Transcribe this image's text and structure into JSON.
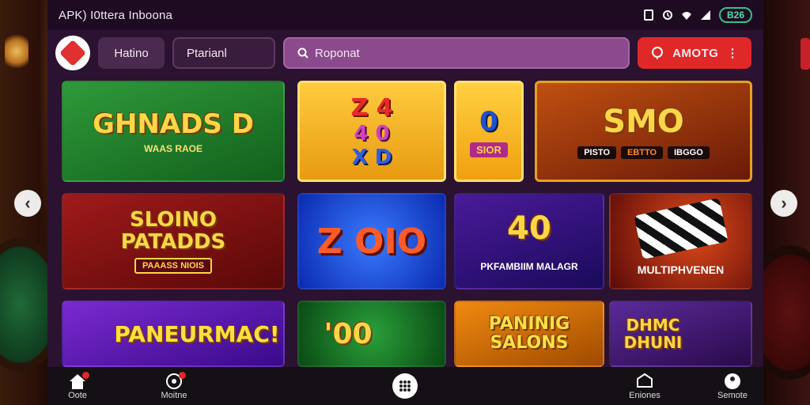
{
  "statusbar": {
    "title": "APK) I0ttera Inboona",
    "battery": "B26"
  },
  "topbar": {
    "pill_a": "Hatino",
    "pill_b": "Ptarianl",
    "search_placeholder": "Roponat",
    "promo_label": "AMOTG",
    "promo_menu": "⋮"
  },
  "tiles": {
    "t1": {
      "title": "GHNADS D",
      "subtitle": "WAAS RAOE"
    },
    "t2": {
      "line1": "Z 4",
      "line2": "4 0",
      "line3": "X D"
    },
    "t3": {
      "digit": "0",
      "label": "SIOR"
    },
    "t4": {
      "title": "SMO",
      "tags": [
        "PISTO",
        "EBTTO",
        "IBGGO"
      ]
    },
    "t5": {
      "title": "SLOINO PATADDS",
      "subtitle": "PAAASS NIOIS"
    },
    "t6": {
      "title": "Z OIO"
    },
    "t7": {
      "title": "40",
      "subtitle": "PKFAMBIIM MALAGR"
    },
    "t8": {
      "subtitle": "MULTIPHVENEN"
    },
    "t9": {
      "title": "PANEURMAC!"
    },
    "t10": {
      "title": "'00"
    },
    "t11": {
      "title": "PANINIG SALONS"
    },
    "t12": {
      "title": "DHMC DHUNI"
    }
  },
  "nav": {
    "home": "Oote",
    "moitne": "Moitne",
    "right1": "Eniones",
    "right2": "Semote"
  },
  "colors": {
    "accent_red": "#e02828",
    "search_purple": "#8a4a8c",
    "battery_green": "#2ec48a"
  }
}
